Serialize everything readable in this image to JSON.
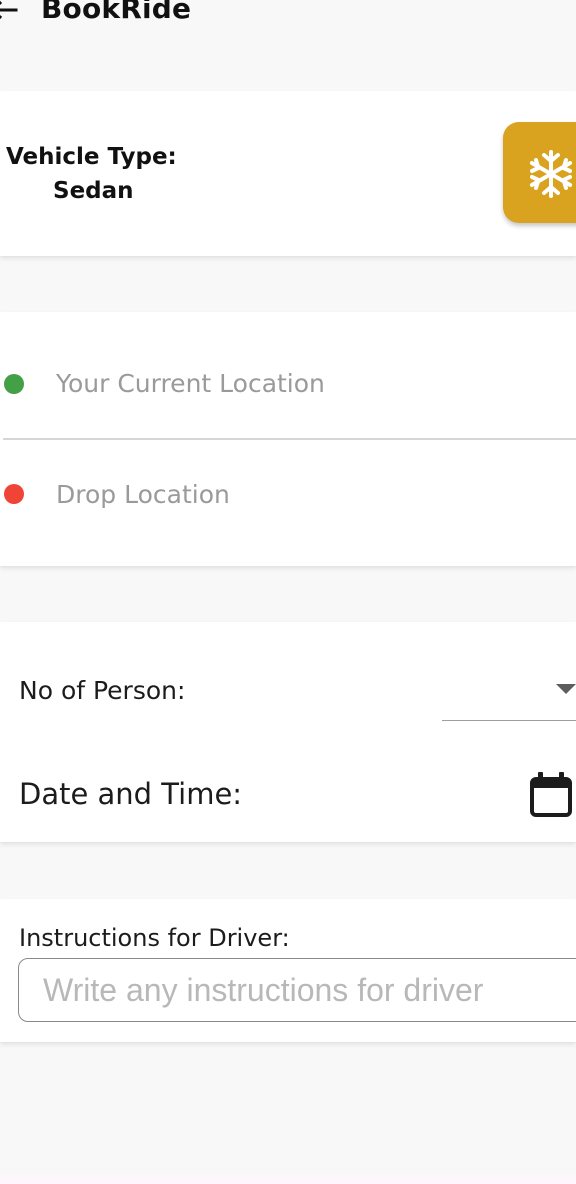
{
  "appbar": {
    "title": "BookRide",
    "back_icon": "arrow-back-icon"
  },
  "vehicle": {
    "type_label": "Vehicle Type:",
    "type_value": "Sedan",
    "ac_icon": "snowflake-icon",
    "ac_color": "#d9a21f"
  },
  "location": {
    "current_placeholder": "Your Current Location",
    "drop_placeholder": "Drop Location",
    "current_dot_color": "#43a047",
    "drop_dot_color": "#f04436"
  },
  "details": {
    "persons_label": "No of Person:",
    "persons_value": "",
    "date_label": "Date and Time:",
    "calendar_icon": "calendar-icon"
  },
  "instructions": {
    "label": "Instructions for Driver:",
    "placeholder": "Write any instructions for driver",
    "value": ""
  }
}
